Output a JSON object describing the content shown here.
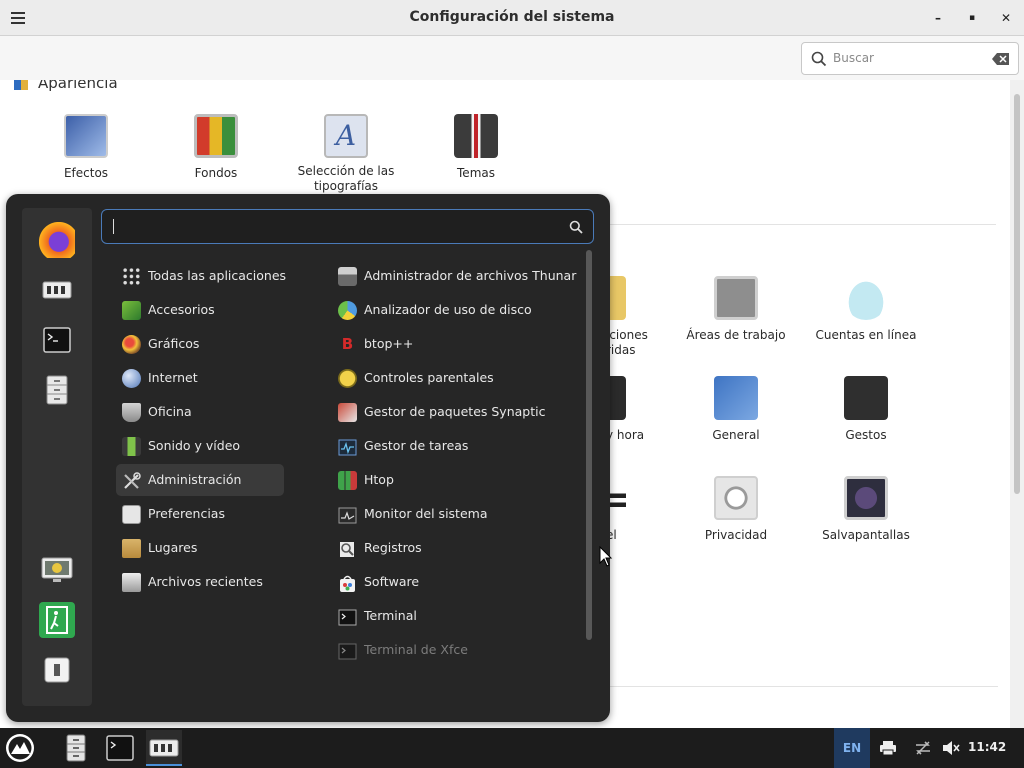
{
  "window": {
    "title": "Configuración del sistema",
    "minimize": "–",
    "maximize": "▪",
    "close": "✕"
  },
  "search": {
    "placeholder": "Buscar"
  },
  "category": {
    "title": "Apariencia"
  },
  "appearance_items": [
    {
      "label": "Efectos",
      "icon": "effects-icon"
    },
    {
      "label": "Fondos",
      "icon": "backgrounds-icon"
    },
    {
      "label": "Selección de las tipografías",
      "icon": "fonts-icon"
    },
    {
      "label": "Temas",
      "icon": "themes-icon"
    }
  ],
  "partial_items": [
    {
      "label": "iciones\nridas"
    },
    {
      "label": "y hora"
    },
    {
      "label": "el"
    }
  ],
  "preference_items": [
    {
      "label": "Áreas de trabajo",
      "icon": "workspaces-icon"
    },
    {
      "label": "Cuentas en línea",
      "icon": "online-accounts-icon"
    },
    {
      "label": "General",
      "icon": "general-icon"
    },
    {
      "label": "Gestos",
      "icon": "gestures-icon"
    },
    {
      "label": "Privacidad",
      "icon": "privacy-icon"
    },
    {
      "label": "Salvapantallas",
      "icon": "screensaver-icon"
    }
  ],
  "menu": {
    "search_value": "",
    "categories": [
      {
        "label": "Todas las aplicaciones",
        "icon": "grid-icon"
      },
      {
        "label": "Accesorios",
        "icon": "accessories-icon"
      },
      {
        "label": "Gráficos",
        "icon": "graphics-icon"
      },
      {
        "label": "Internet",
        "icon": "internet-icon"
      },
      {
        "label": "Oficina",
        "icon": "office-icon"
      },
      {
        "label": "Sonido y vídeo",
        "icon": "multimedia-icon"
      },
      {
        "label": "Administración",
        "icon": "administration-icon",
        "active": true
      },
      {
        "label": "Preferencias",
        "icon": "preferences-icon"
      },
      {
        "label": "Lugares",
        "icon": "folder-icon"
      },
      {
        "label": "Archivos recientes",
        "icon": "recent-files-icon"
      }
    ],
    "apps": [
      {
        "label": "Administrador de archivos Thunar",
        "icon": "thunar-icon"
      },
      {
        "label": "Analizador de uso de disco",
        "icon": "disk-usage-icon"
      },
      {
        "label": "btop++",
        "icon": "btop-icon"
      },
      {
        "label": "Controles parentales",
        "icon": "parental-controls-icon"
      },
      {
        "label": "Gestor de paquetes Synaptic",
        "icon": "synaptic-icon"
      },
      {
        "label": "Gestor de tareas",
        "icon": "task-manager-icon"
      },
      {
        "label": "Htop",
        "icon": "htop-icon"
      },
      {
        "label": "Monitor del sistema",
        "icon": "system-monitor-icon"
      },
      {
        "label": "Registros",
        "icon": "logs-icon"
      },
      {
        "label": "Software",
        "icon": "software-icon"
      },
      {
        "label": "Terminal",
        "icon": "terminal-icon"
      },
      {
        "label": "Terminal de Xfce",
        "icon": "xfce-terminal-icon",
        "dim": true
      }
    ]
  },
  "taskbar": {
    "language": "EN",
    "clock": "11:42"
  },
  "colors": {
    "menu_bg": "#262626",
    "menu_sidebar": "#323232",
    "accent": "#4a7ab8",
    "taskbar": "#1c1c1c"
  }
}
